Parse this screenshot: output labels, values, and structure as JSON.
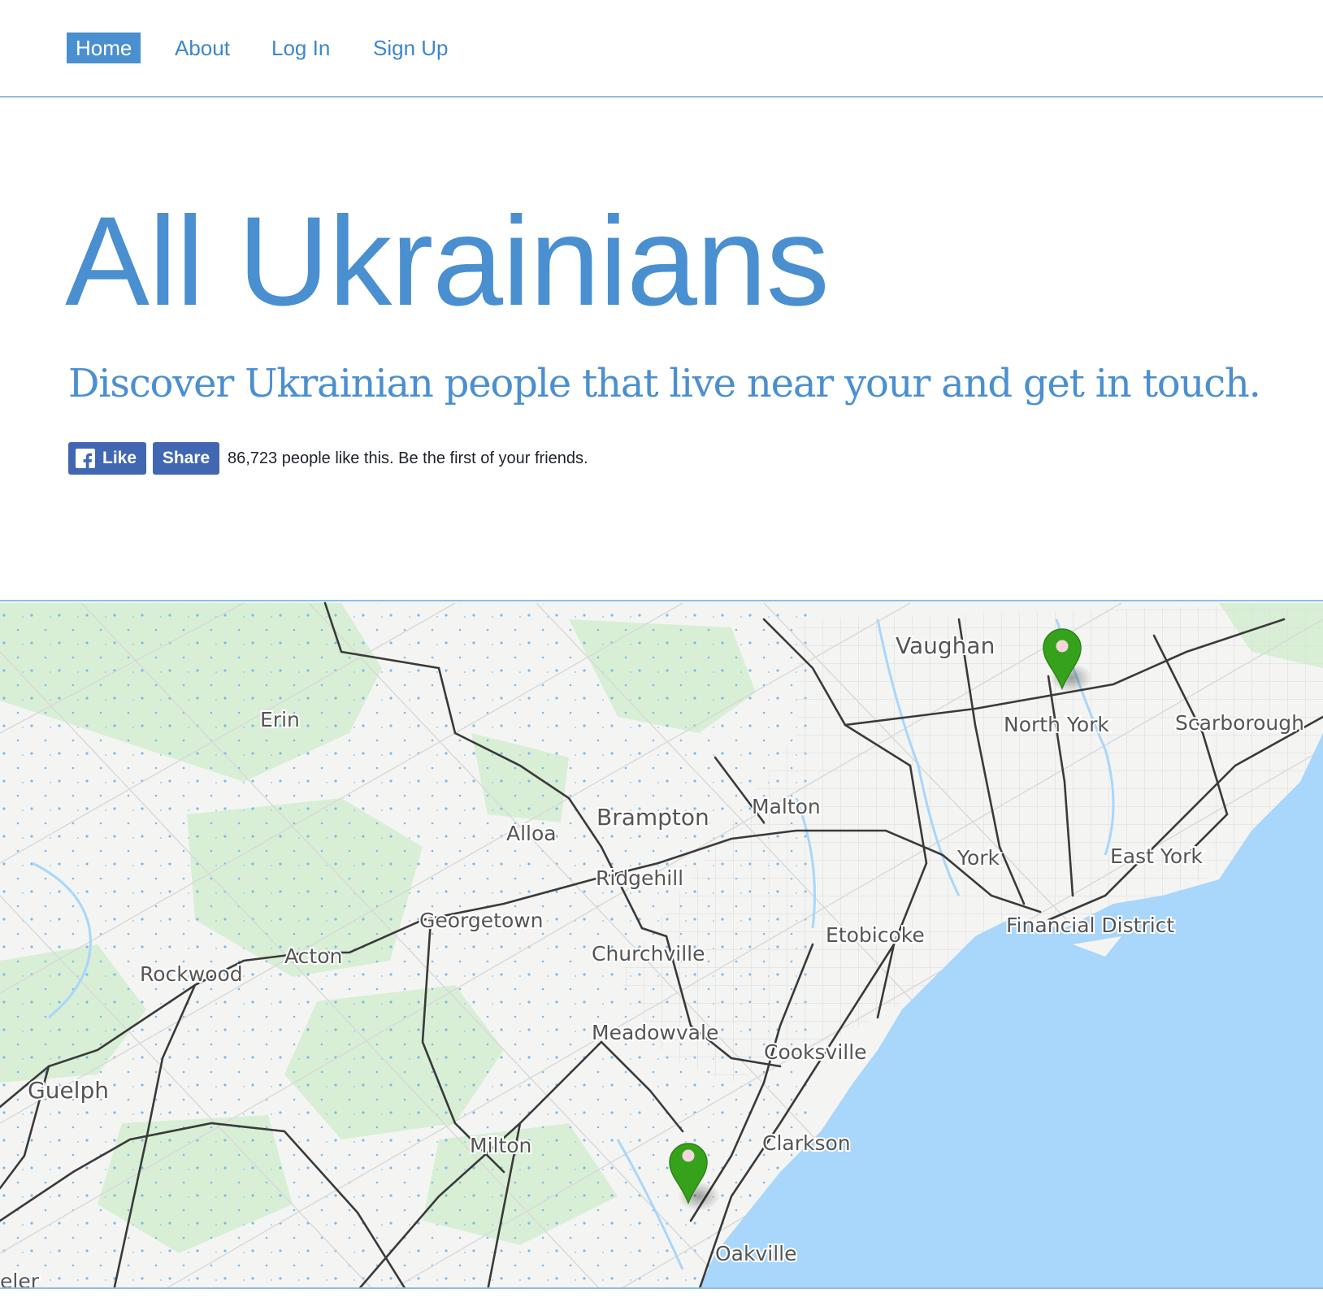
{
  "nav": {
    "items": [
      {
        "label": "Home",
        "active": true
      },
      {
        "label": "About"
      },
      {
        "label": "Log In"
      },
      {
        "label": "Sign Up"
      }
    ]
  },
  "hero": {
    "title": "All Ukrainians",
    "subtitle": "Discover Ukrainian people that live near your and get in touch."
  },
  "facebook": {
    "like_label": "Like",
    "share_label": "Share",
    "social_text": "86,723 people like this. Be the first of your friends."
  },
  "map": {
    "cities": {
      "vaughan": "Vaughan",
      "north_york": "North York",
      "scarborough": "Scarborough",
      "erin": "Erin",
      "brampton": "Brampton",
      "malton": "Malton",
      "alloa": "Alloa",
      "york": "York",
      "east_york": "East York",
      "ridgehill": "Ridgehill",
      "georgetown": "Georgetown",
      "etobicoke": "Etobicoke",
      "financial_district": "Financial District",
      "churchville": "Churchville",
      "acton": "Acton",
      "rockwood": "Rockwood",
      "meadowvale": "Meadowvale",
      "cooksville": "Cooksville",
      "guelph": "Guelph",
      "milton": "Milton",
      "clarkson": "Clarkson",
      "oakville": "Oakville",
      "eler": "eler"
    },
    "colors": {
      "land": "#f4f5f3",
      "water": "#a9d6fb",
      "marker": "#36a21c"
    },
    "markers": [
      "north-york",
      "oakville"
    ]
  }
}
